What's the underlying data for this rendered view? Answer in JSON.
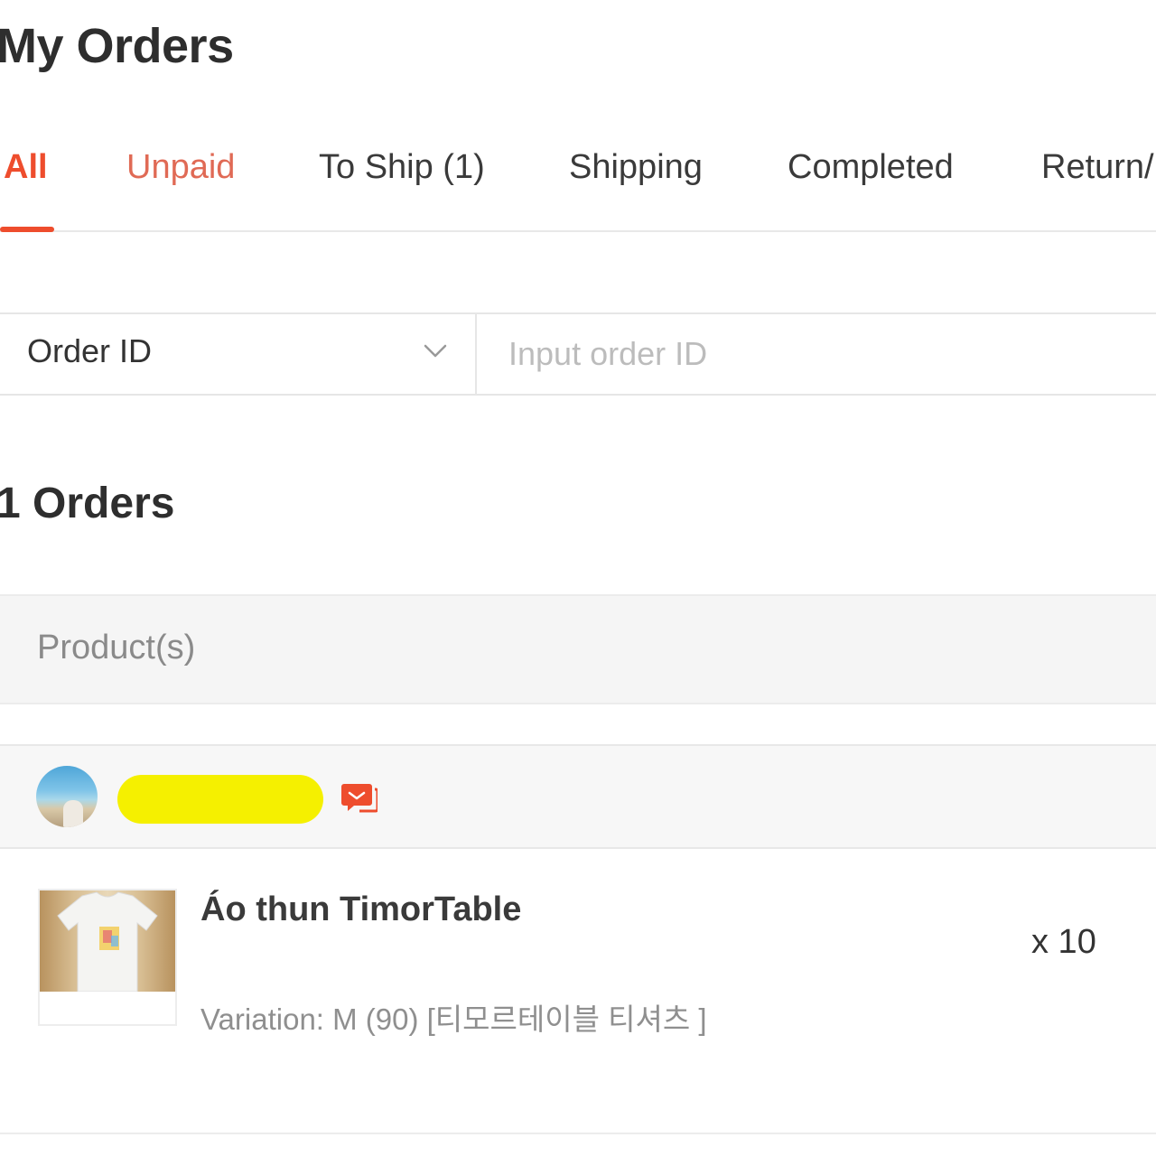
{
  "page": {
    "title": "My Orders"
  },
  "tabs": [
    {
      "label": "All"
    },
    {
      "label": "Unpaid"
    },
    {
      "label": "To Ship (1)"
    },
    {
      "label": "Shipping"
    },
    {
      "label": "Completed"
    },
    {
      "label": "Return/"
    }
  ],
  "active_tab": "All",
  "search": {
    "field_selected": "Order ID",
    "placeholder": "Input order ID",
    "value": ""
  },
  "orders": {
    "count_label": "1 Orders",
    "header_label": "Product(s)"
  },
  "shop": {
    "name": "",
    "name_redacted": true
  },
  "product": {
    "name": "Áo thun TimorTable",
    "variation": "Variation: M (90) [티모르테이블 티셔츠 ]",
    "quantity": "x 10"
  },
  "colors": {
    "accent": "#ee4d2d",
    "redaction": "#f5f000"
  },
  "icons": {
    "dropdown": "chevron-down-icon",
    "chat": "chat-icon"
  }
}
